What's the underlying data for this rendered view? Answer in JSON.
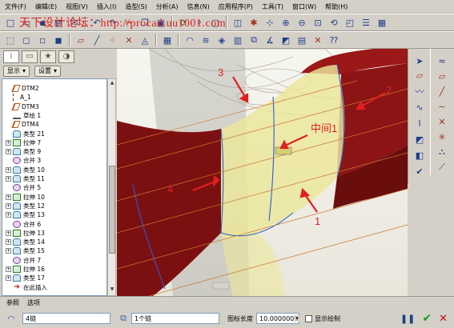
{
  "menu": [
    "文件(F)",
    "编辑(E)",
    "视图(V)",
    "插入(I)",
    "造型(S)",
    "分析(A)",
    "信息(N)",
    "应用程序(P)",
    "工具(T)",
    "窗口(W)",
    "帮助(H)"
  ],
  "watermark": "天下设计论坛：http://procad.uu1001.com",
  "toolbar1_icons": [
    "new-icon",
    "open-icon",
    "save-icon",
    "print-icon",
    "email-icon",
    "undo-icon",
    "redo-icon",
    "cut-icon",
    "copy-icon",
    "paste-icon",
    "regenerate-icon",
    "find-icon",
    "select-box-icon",
    "repaint-icon",
    "spin-center-icon",
    "orient-icon",
    "zoom-in-icon",
    "zoom-out-icon",
    "refit-icon",
    "reorient-icon",
    "saved-views-icon",
    "layers-icon",
    "view-manager-icon"
  ],
  "toolbar2_icons": [
    "wireframe-icon",
    "hidden-line-icon",
    "no-hidden-icon",
    "shading-icon",
    "datum-planes-icon",
    "datum-axes-icon",
    "datum-points-icon",
    "csys-icon",
    "annotation-display-icon",
    "model-tree-settings-icon",
    "curvature-icon",
    "reflection-icon",
    "draft-check-icon",
    "section-analysis-icon",
    "offset-icon",
    "dihedral-icon",
    "slope-icon",
    "saved-analysis-icon",
    "hide-all-icon",
    "context-help-icon"
  ],
  "nav": {
    "show_label": "显示",
    "settings_label": "设置"
  },
  "tree_items": [
    {
      "label": "DTM2",
      "icon": "datum"
    },
    {
      "label": "A_1",
      "icon": "axis"
    },
    {
      "label": "DTM3",
      "icon": "datum"
    },
    {
      "label": "草绘 1",
      "icon": "sketch"
    },
    {
      "label": "DTM4",
      "icon": "datum"
    },
    {
      "label": "类型 21",
      "icon": "blend"
    },
    {
      "label": "拉伸 7",
      "icon": "ext",
      "expand": true
    },
    {
      "label": "类型 9",
      "icon": "blend",
      "expand": true
    },
    {
      "label": "合并 3",
      "icon": "merge"
    },
    {
      "label": "类型 10",
      "icon": "blend",
      "expand": true
    },
    {
      "label": "类型 11",
      "icon": "blend",
      "expand": true
    },
    {
      "label": "合并 5",
      "icon": "merge"
    },
    {
      "label": "拉伸 10",
      "icon": "ext",
      "expand": true
    },
    {
      "label": "类型 12",
      "icon": "blend",
      "expand": true
    },
    {
      "label": "类型 13",
      "icon": "blend",
      "expand": true
    },
    {
      "label": "合并 6",
      "icon": "merge"
    },
    {
      "label": "拉伸 13",
      "icon": "ext",
      "expand": true
    },
    {
      "label": "类型 14",
      "icon": "blend",
      "expand": true
    },
    {
      "label": "类型 15",
      "icon": "blend",
      "expand": true
    },
    {
      "label": "合并 7",
      "icon": "merge"
    },
    {
      "label": "拉伸 16",
      "icon": "ext",
      "expand": true
    },
    {
      "label": "类型 17",
      "icon": "blend",
      "expand": true
    },
    {
      "label": "在此插入",
      "icon": "insert"
    }
  ],
  "annotations": {
    "label1": "1",
    "label2": "2",
    "label3": "3",
    "label4": "4",
    "label_mid": "中间1"
  },
  "right_icons_1": [
    "select-arrow-icon",
    "datum-plane-tool-icon",
    "datum-axis-tool-icon",
    "datum-curve-tool-icon",
    "datum-point-tool-icon",
    "boundary-blend-tool-icon",
    "style-tool-icon",
    "variable-section-sweep-icon"
  ],
  "right_icons_2": [
    "surface-analysis-icon",
    "plane-icon",
    "curve-icon",
    "sketch-curve-icon",
    "point-icon",
    "mirror-icon",
    "trim-icon",
    "extend-icon"
  ],
  "dashboard": {
    "tabs": [
      "参照",
      "选项"
    ],
    "chain_value": "4链",
    "chain_count": "1个链",
    "icon_length_label": "图标长度",
    "icon_length_value": "10.000000",
    "show_draw_label": "显示绘制"
  },
  "colors": {
    "surface_red": "#8c1414",
    "surface_yellow": "#e8e48c",
    "annotation": "#e02020",
    "background": "#d4d0c8"
  }
}
